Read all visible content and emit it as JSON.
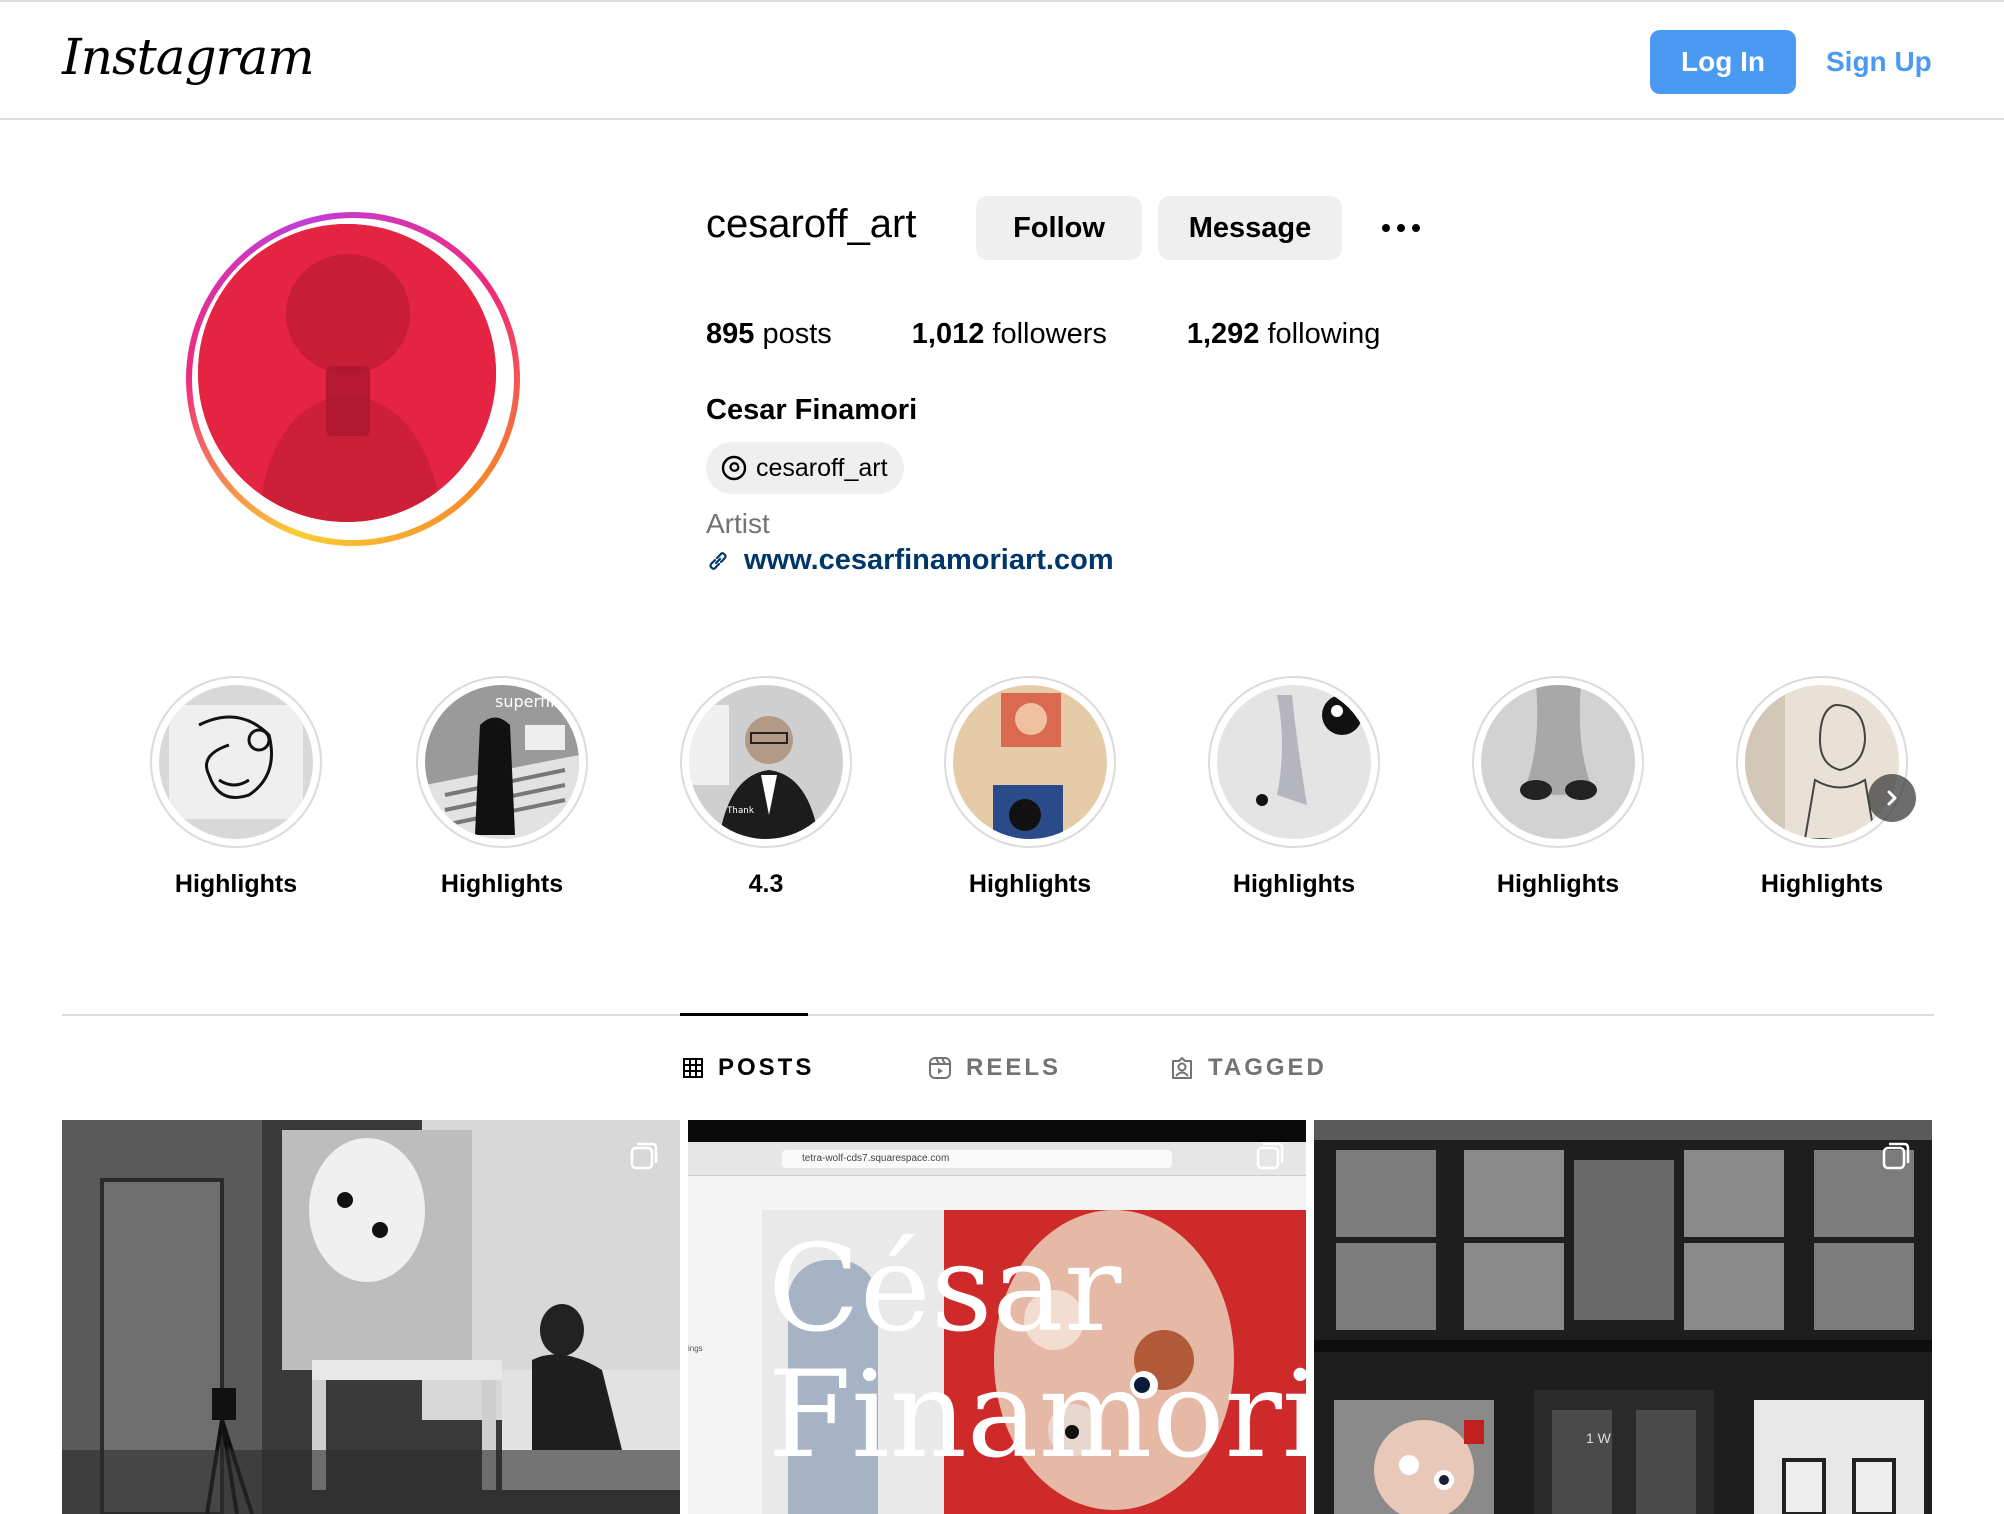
{
  "header": {
    "logo_text": "Instagram",
    "login_label": "Log In",
    "signup_label": "Sign Up",
    "accent_color": "#4a9af3"
  },
  "profile": {
    "username": "cesaroff_art",
    "follow_label": "Follow",
    "message_label": "Message",
    "stats": {
      "posts_count": "895",
      "posts_label": "posts",
      "followers_count": "1,012",
      "followers_label": "followers",
      "following_count": "1,292",
      "following_label": "following"
    },
    "full_name": "Cesar Finamori",
    "threads_handle": "cesaroff_art",
    "bio": "Artist",
    "website": "www.cesarfinamoriart.com"
  },
  "highlights": [
    {
      "label": "Highlights"
    },
    {
      "label": "Highlights"
    },
    {
      "label": "4.3"
    },
    {
      "label": "Highlights"
    },
    {
      "label": "Highlights"
    },
    {
      "label": "Highlights"
    },
    {
      "label": "Highlights"
    }
  ],
  "tabs": [
    {
      "label": "POSTS",
      "icon": "grid-icon",
      "active": true
    },
    {
      "label": "REELS",
      "icon": "reels-icon",
      "active": false
    },
    {
      "label": "TAGGED",
      "icon": "tagged-icon",
      "active": false
    }
  ],
  "posts": [
    {
      "description": "studio-photo"
    },
    {
      "url_text": "tetra-wolf-cds7.squarespace.com",
      "overlay_line1": "César",
      "overlay_line2": "Finamori",
      "side_text": "ings"
    },
    {
      "door_text": "1 W"
    }
  ]
}
